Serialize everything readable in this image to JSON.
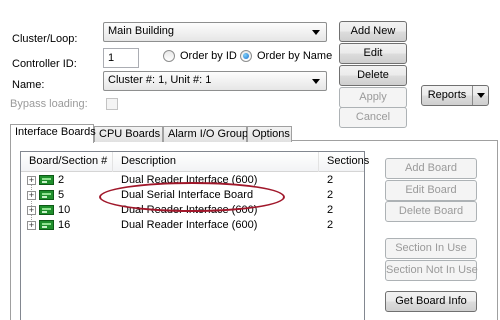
{
  "form": {
    "cluster_label": "Cluster/Loop:",
    "cluster_value": "Main Building",
    "controller_id_label": "Controller ID:",
    "controller_id_value": "1",
    "order_by_id_label": "Order by ID",
    "order_by_name_label": "Order by Name",
    "order_selected": "Order by Name",
    "name_label": "Name:",
    "name_value": "Cluster #: 1, Unit #: 1",
    "bypass_label": "Bypass loading:",
    "bypass_checked": false
  },
  "buttons": {
    "add_new": "Add New",
    "edit": "Edit",
    "delete": "Delete",
    "apply": "Apply",
    "cancel": "Cancel",
    "reports": "Reports"
  },
  "tabs": [
    {
      "label": "Interface Boards",
      "active": true
    },
    {
      "label": "CPU Boards",
      "active": false
    },
    {
      "label": "Alarm I/O Groups",
      "active": false
    },
    {
      "label": "Options",
      "active": false
    }
  ],
  "board_table": {
    "columns": [
      "Board/Section #",
      "Description",
      "Sections"
    ],
    "rows": [
      {
        "board": "2",
        "description": "Dual Reader Interface (600)",
        "sections": "2"
      },
      {
        "board": "5",
        "description": "Dual Serial Interface Board",
        "sections": "2"
      },
      {
        "board": "10",
        "description": "Dual Reader Interface (600)",
        "sections": "2"
      },
      {
        "board": "16",
        "description": "Dual Reader Interface (600)",
        "sections": "2"
      }
    ]
  },
  "side_buttons": {
    "add_board": "Add Board",
    "edit_board": "Edit Board",
    "delete_board": "Delete Board",
    "section_in_use": "Section In Use",
    "section_not_in_use": "Section Not In Use",
    "get_board_info": "Get Board Info"
  },
  "colors": {
    "highlight_ring": "#a0172a",
    "board_icon": "#1f8f2c"
  }
}
